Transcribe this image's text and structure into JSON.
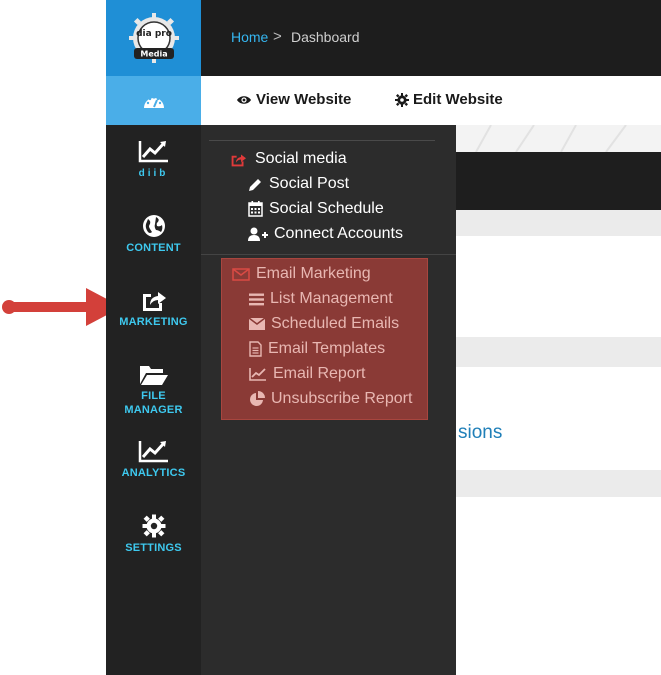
{
  "brand": {
    "logo_text": "Media",
    "logo_mark": "dia pro"
  },
  "colors": {
    "accent": "#1f8fd6",
    "sidebar_text": "#3ec9ef",
    "email_highlight": "#8a3a36",
    "arrow": "#d3403a"
  },
  "breadcrumb": {
    "home": "Home",
    "separator": ">",
    "current": "Dashboard"
  },
  "toolbar": {
    "view_website": "View Website",
    "edit_website": "Edit Website"
  },
  "sidebar": {
    "items": [
      {
        "label": "diib",
        "icon": "chart-line-icon"
      },
      {
        "label": "CONTENT",
        "icon": "globe-icon"
      },
      {
        "label": "MARKETING",
        "icon": "share-icon"
      },
      {
        "label": "FILE",
        "label2": "MANAGER",
        "icon": "folder-open-icon"
      },
      {
        "label": "ANALYTICS",
        "icon": "chart-line-icon"
      },
      {
        "label": "SETTINGS",
        "icon": "gear-icon"
      }
    ]
  },
  "flyout": {
    "social": {
      "title": "Social media",
      "items": [
        "Social Post",
        "Social Schedule",
        "Connect Accounts"
      ]
    },
    "email": {
      "title": "Email Marketing",
      "items": [
        "List Management",
        "Scheduled Emails",
        "Email Templates",
        "Email Report",
        "Unsubscribe Report"
      ]
    }
  },
  "background": {
    "partial_text": "sions"
  }
}
